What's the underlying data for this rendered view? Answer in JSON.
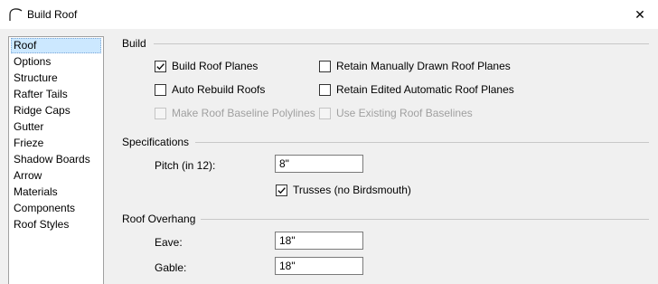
{
  "window": {
    "title": "Build Roof",
    "close_glyph": "✕"
  },
  "sidebar": {
    "items": [
      {
        "label": "Roof",
        "selected": true
      },
      {
        "label": "Options"
      },
      {
        "label": "Structure"
      },
      {
        "label": "Rafter Tails"
      },
      {
        "label": "Ridge Caps"
      },
      {
        "label": "Gutter"
      },
      {
        "label": "Frieze"
      },
      {
        "label": "Shadow Boards"
      },
      {
        "label": "Arrow"
      },
      {
        "label": "Materials"
      },
      {
        "label": "Components"
      },
      {
        "label": "Roof Styles"
      }
    ]
  },
  "build": {
    "title": "Build",
    "build_roof_planes": {
      "label": "Build Roof Planes",
      "checked": true
    },
    "auto_rebuild_roofs": {
      "label": "Auto Rebuild Roofs",
      "checked": false
    },
    "make_roof_baseline_polylines": {
      "label": "Make Roof Baseline Polylines",
      "checked": false,
      "disabled": true
    },
    "retain_manually_drawn": {
      "label": "Retain Manually Drawn Roof Planes",
      "checked": false
    },
    "retain_edited_automatic": {
      "label": "Retain Edited Automatic Roof Planes",
      "checked": false
    },
    "use_existing_baselines": {
      "label": "Use Existing Roof Baselines",
      "checked": false,
      "disabled": true
    }
  },
  "specifications": {
    "title": "Specifications",
    "pitch_label": "Pitch (in 12):",
    "pitch_value": "8\"",
    "trusses": {
      "label": "Trusses (no Birdsmouth)",
      "checked": true
    }
  },
  "overhang": {
    "title": "Roof Overhang",
    "eave_label": "Eave:",
    "eave_value": "18\"",
    "gable_label": "Gable:",
    "gable_value": "18\""
  }
}
